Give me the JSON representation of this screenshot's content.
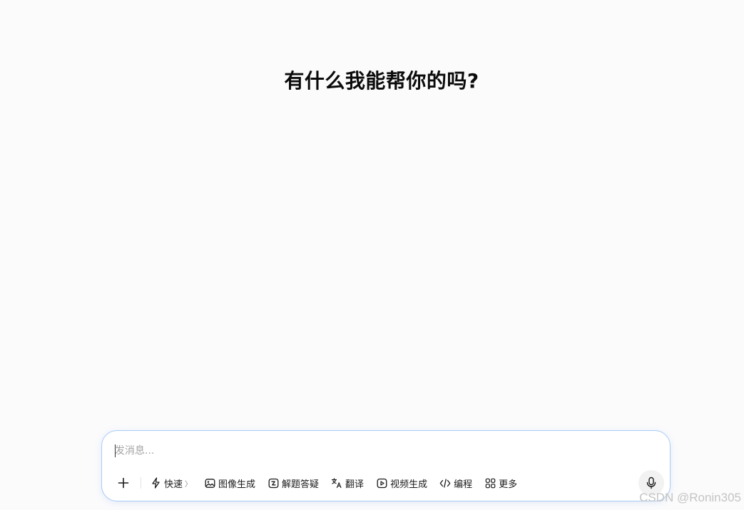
{
  "headline": "有什么我能帮你的吗?",
  "composer": {
    "placeholder": "发消息...",
    "tools": [
      {
        "label": "快速",
        "icon": "lightning-icon",
        "chevron": "〉"
      },
      {
        "label": "图像生成",
        "icon": "image-icon"
      },
      {
        "label": "解题答疑",
        "icon": "problem-solving-icon"
      },
      {
        "label": "翻译",
        "icon": "translate-icon"
      },
      {
        "label": "视频生成",
        "icon": "video-icon"
      },
      {
        "label": "编程",
        "icon": "code-icon"
      },
      {
        "label": "更多",
        "icon": "grid-icon"
      }
    ],
    "plus_icon": "plus-icon",
    "mic_icon": "microphone-icon"
  },
  "watermark": "CSDN @Ronin305"
}
